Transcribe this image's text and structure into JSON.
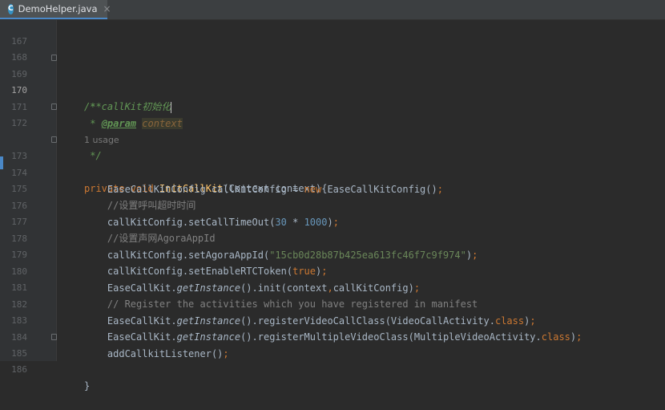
{
  "tab": {
    "icon": "C",
    "title": "DemoHelper.java",
    "close": "×"
  },
  "lines": {
    "167": "167",
    "168": "168",
    "169": "169",
    "170": "170",
    "171": "171",
    "172": "172",
    "173": "173",
    "174": "174",
    "175": "175",
    "176": "176",
    "177": "177",
    "178": "178",
    "179": "179",
    "180": "180",
    "181": "181",
    "182": "182",
    "183": "183",
    "184": "184",
    "185": "185",
    "186": "186"
  },
  "code": {
    "l169": "/**",
    "l170": " * callKit初始化",
    "l171_star": " * ",
    "l171_tag": "@param",
    "l171_param": "context",
    "l172": " */",
    "usage": "1 usage",
    "l173_kw": "private void ",
    "l173_fn": "InitCallKit",
    "l173_rest": "(Context context){",
    "l174_a": "    EaseCallKitConfig callKitConfig = ",
    "l174_new": "new",
    "l174_b": " EaseCallKitConfig()",
    "l174_semi": ";",
    "l175": "    //设置呼叫超时时间",
    "l176_a": "    callKitConfig.setCallTimeOut(",
    "l176_n1": "30",
    "l176_op": " * ",
    "l176_n2": "1000",
    "l176_b": ")",
    "l176_semi": ";",
    "l177": "    //设置声网AgoraAppId",
    "l178_a": "    callKitConfig.setAgoraAppId(",
    "l178_str": "\"15cb0d28b87b425ea613fc46f7c9f974\"",
    "l178_b": ")",
    "l178_semi": ";",
    "l179_a": "    callKitConfig.setEnableRTCToken(",
    "l179_kw": "true",
    "l179_b": ")",
    "l179_semi": ";",
    "l180_a": "    EaseCallKit.",
    "l180_it": "getInstance",
    "l180_b": "().init(context",
    "l180_comma": ",",
    "l180_c": "callKitConfig)",
    "l180_semi": ";",
    "l181": "    // Register the activities which you have registered in manifest",
    "l182_a": "    EaseCallKit.",
    "l182_it": "getInstance",
    "l182_b": "().registerVideoCallClass(VideoCallActivity.",
    "l182_cls": "class",
    "l182_c": ")",
    "l182_semi": ";",
    "l183_a": "    EaseCallKit.",
    "l183_it": "getInstance",
    "l183_b": "().registerMultipleVideoClass(MultipleVideoActivity.",
    "l183_cls": "class",
    "l183_c": ")",
    "l183_semi": ";",
    "l184_a": "    addCallkitListener()",
    "l184_semi": ";",
    "l185": "}"
  }
}
